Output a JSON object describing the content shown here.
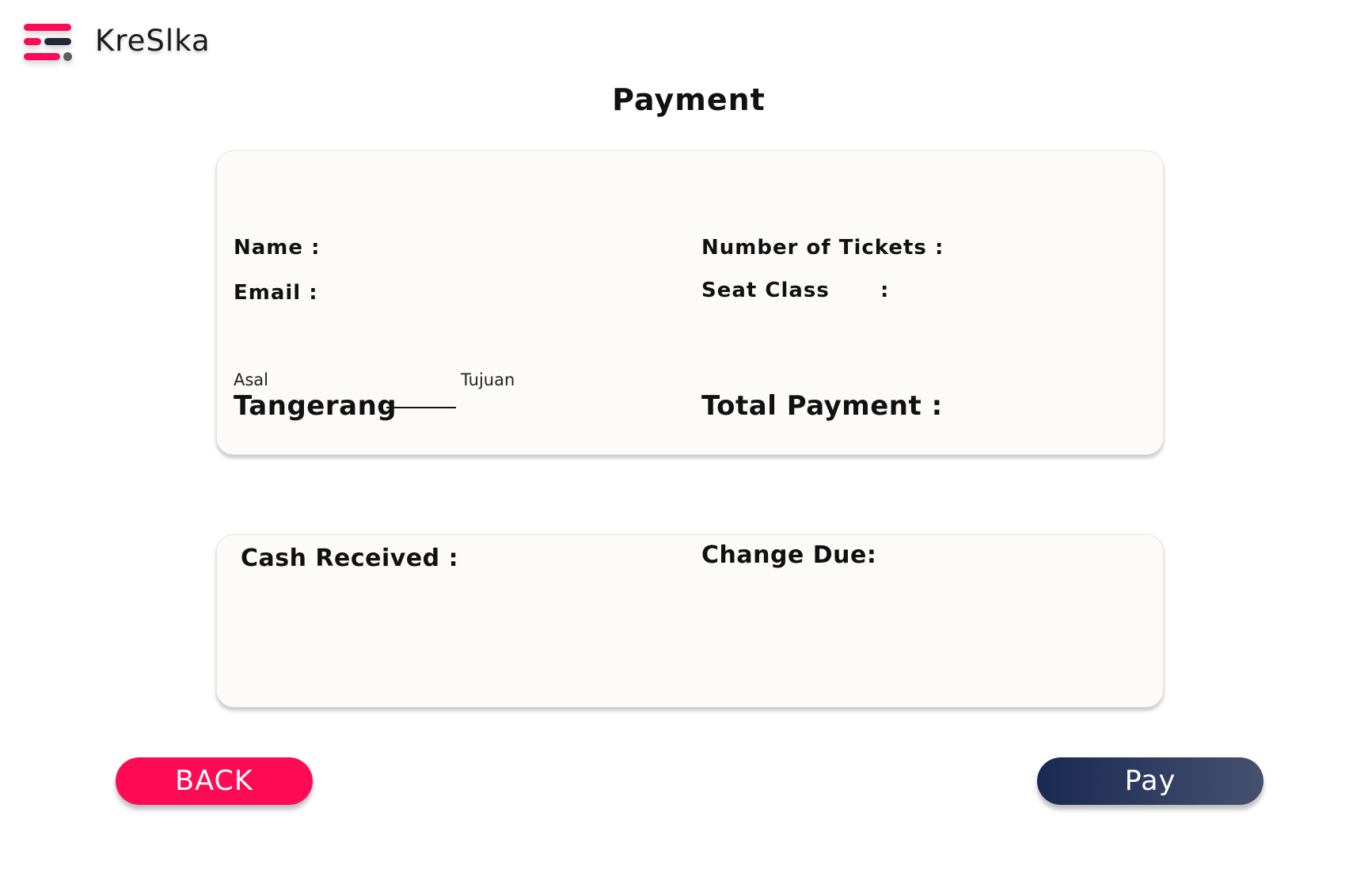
{
  "header": {
    "brand": "KreSlka",
    "logo_icon": "kreslka-logo-icon",
    "page_title": "Payment"
  },
  "booking_info": {
    "name_label": "Name :",
    "email_label": "Email  :",
    "tickets_label": "Number of Tickets :",
    "seat_class_label": "Seat Class",
    "seat_class_colon": ":",
    "origin_caption": "Asal",
    "destination_caption": "Tujuan",
    "origin_value": "Tangerang",
    "total_payment_label": "Total Payment :"
  },
  "cash": {
    "cash_received_label": "Cash Received :",
    "change_due_label": "Change Due:"
  },
  "actions": {
    "back_label": "BACK",
    "pay_label": "Pay"
  },
  "colors": {
    "accent": "#ff0a54",
    "navy": "#1a2953",
    "card_bg": "#fcfbfa"
  }
}
